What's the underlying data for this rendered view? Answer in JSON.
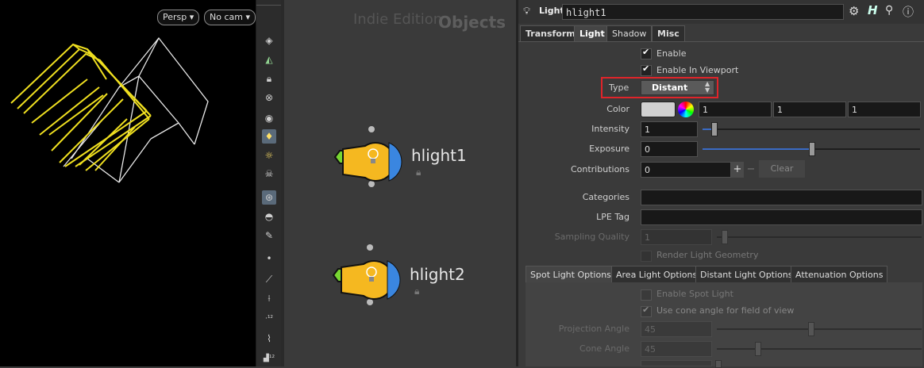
{
  "viewport": {
    "persp_label": "Persp",
    "cam_label": "No cam"
  },
  "toolbar": {
    "icons": [
      "view-icon",
      "geometry-icon",
      "lock-icon",
      "snap-icon",
      "camera-icon",
      "light-bulb-icon",
      "bulb-outline-icon",
      "skull-icon",
      "render-icon",
      "visibility-icon",
      "camera-tool-icon",
      "dot-icon",
      "brush-icon",
      "pin-icon",
      "vertex-12-icon",
      "sweep-icon",
      "vertex-12b-icon"
    ]
  },
  "network": {
    "watermark": "Indie Edition",
    "context_title": "Objects",
    "nodes": [
      {
        "name": "hlight1"
      },
      {
        "name": "hlight2"
      }
    ]
  },
  "params": {
    "node_type": "Light",
    "node_name": "hlight1",
    "tabs": [
      "Transform",
      "Light",
      "Shadow",
      "Misc"
    ],
    "active_tab": "Light",
    "enable_label": "Enable",
    "enable_viewport_label": "Enable In Viewport",
    "type_label": "Type",
    "type_value": "Distant",
    "color_label": "Color",
    "color_values": [
      "1",
      "1",
      "1"
    ],
    "intensity_label": "Intensity",
    "intensity_value": "1",
    "intensity_fraction": 0.05,
    "exposure_label": "Exposure",
    "exposure_value": "0",
    "exposure_fraction": 0.5,
    "contributions_label": "Contributions",
    "contributions_value": "0",
    "clear_label": "Clear",
    "categories_label": "Categories",
    "lpe_label": "LPE Tag",
    "sampling_label": "Sampling Quality",
    "sampling_value": "1",
    "render_geo_label": "Render Light Geometry",
    "subtabs": [
      "Spot Light Options",
      "Area Light Options",
      "Distant Light Options",
      "Attenuation Options"
    ],
    "enable_spot_label": "Enable Spot Light",
    "cone_fov_label": "Use cone angle for field of view",
    "projection_angle_label": "Projection Angle",
    "projection_angle_value": "45",
    "cone_angle_label": "Cone Angle",
    "cone_angle_value": "45"
  },
  "colors": {
    "highlight_box": "#e0242a",
    "bulb_yellow": "#f5b820",
    "bulb_blue": "#3a86e0",
    "bulb_green": "#78d632",
    "wire_yellow": "#f0e020"
  }
}
